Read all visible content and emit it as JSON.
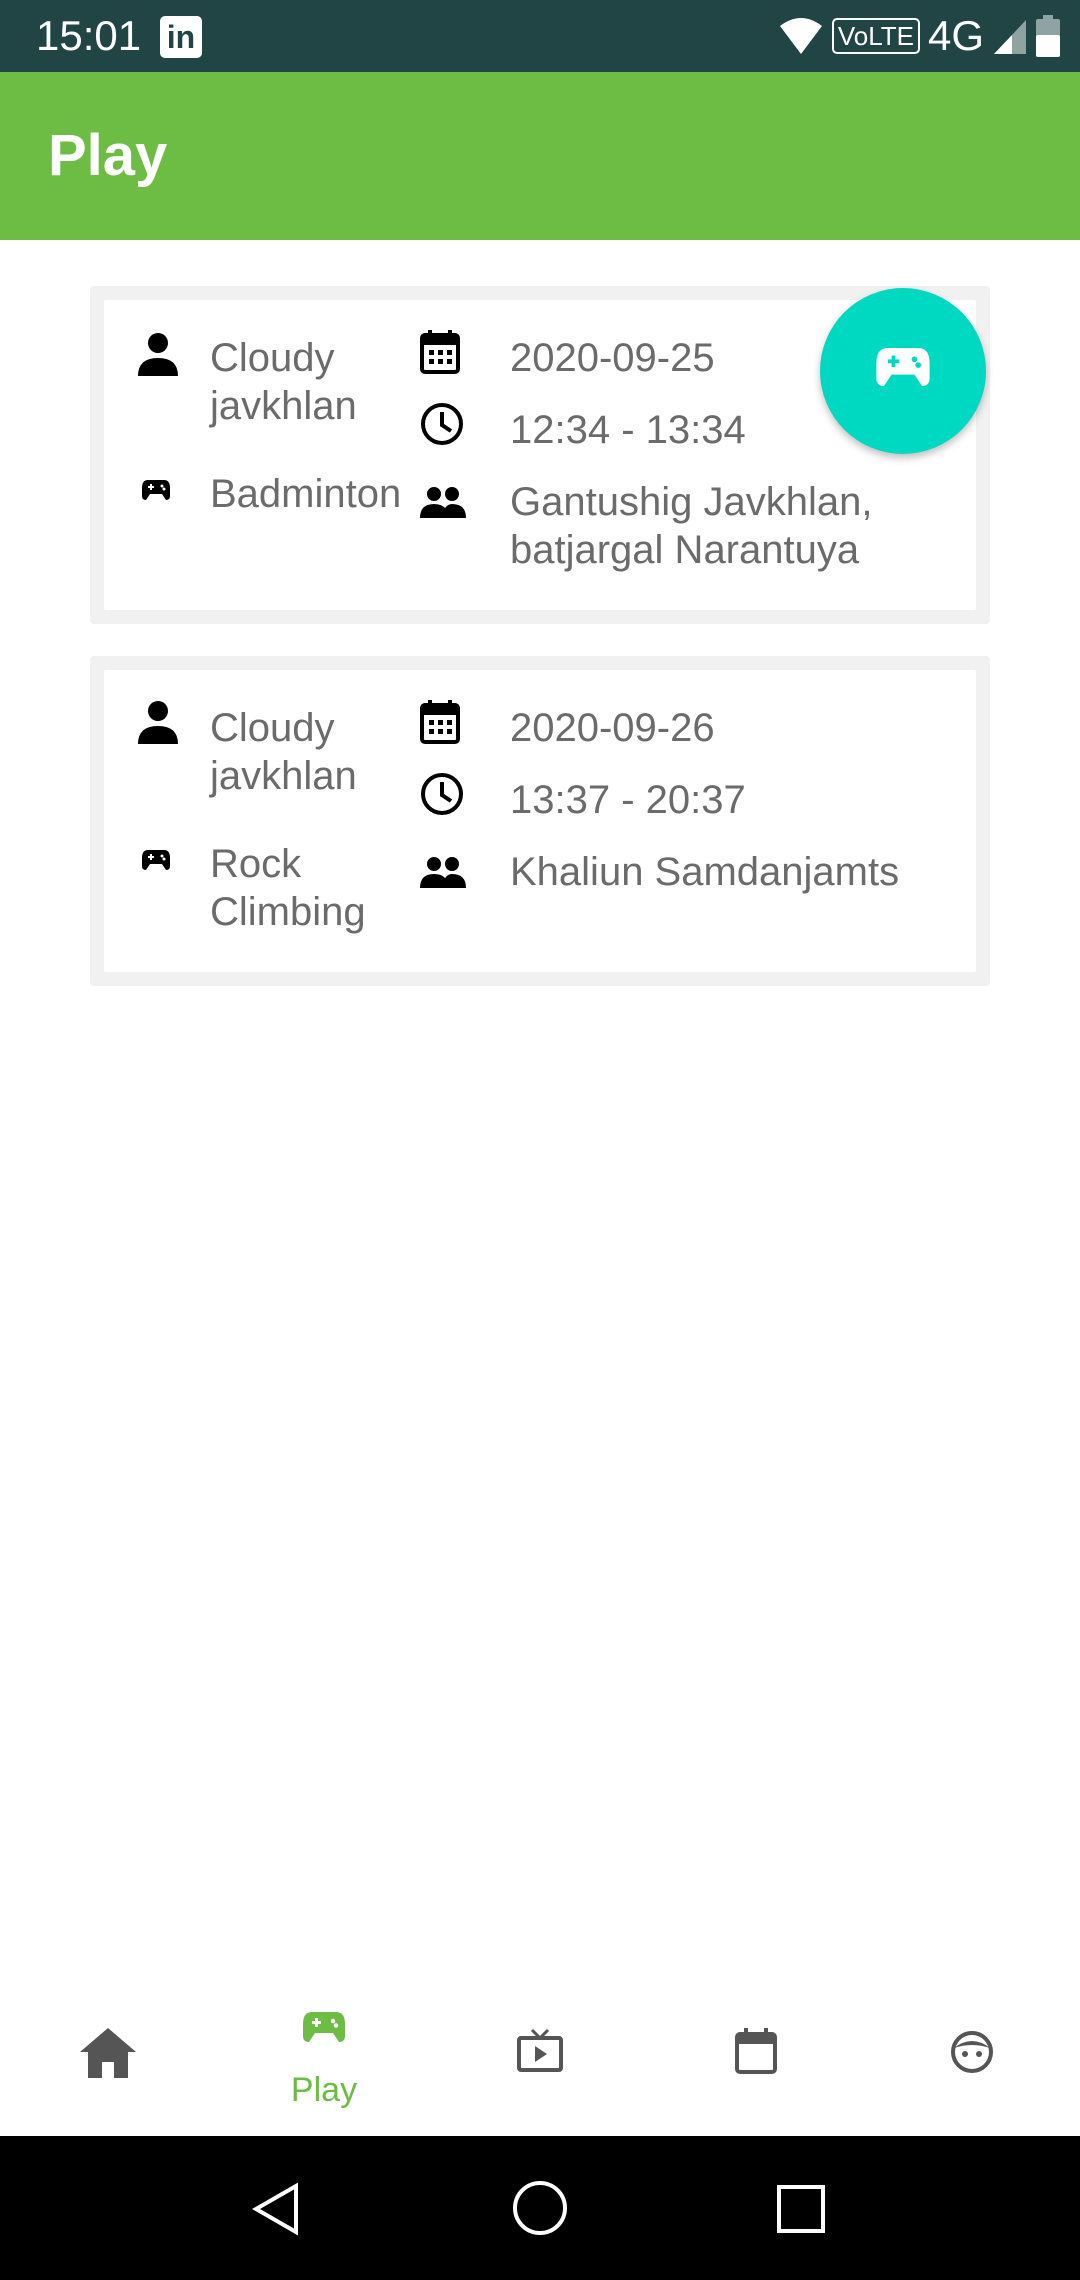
{
  "status_bar": {
    "time": "15:01",
    "network": "4G",
    "volte": "VoLTE",
    "notification_icon": "linkedin-icon"
  },
  "app_bar": {
    "title": "Play"
  },
  "fab": {
    "icon": "gamepad-icon",
    "color": "#00d9c2"
  },
  "games": [
    {
      "organizer": "Cloudy\njavkhlan",
      "organizer_line1": "Cloudy",
      "organizer_line2": "javkhlan",
      "sport_line1": "Badminton",
      "sport_line2": "",
      "date": "2020-09-25",
      "time": "12:34 - 13:34",
      "participants_line1": "Gantushig Javkhlan,",
      "participants_line2": "batjargal Narantuya"
    },
    {
      "organizer_line1": "Cloudy",
      "organizer_line2": "javkhlan",
      "sport_line1": "Rock",
      "sport_line2": "Climbing",
      "date": "2020-09-26",
      "time": "13:37 - 20:37",
      "participants_line1": "Khaliun Samdanjamts",
      "participants_line2": ""
    }
  ],
  "bottom_nav": {
    "items": [
      {
        "icon": "home-icon",
        "label": ""
      },
      {
        "icon": "gamepad-icon",
        "label": "Play",
        "active": true
      },
      {
        "icon": "tv-icon",
        "label": ""
      },
      {
        "icon": "calendar-icon",
        "label": ""
      },
      {
        "icon": "face-icon",
        "label": ""
      }
    ]
  },
  "colors": {
    "accent": "#6dbd45",
    "status_bar": "#214545",
    "fab": "#00d9c2",
    "text": "#6b6b6b"
  }
}
